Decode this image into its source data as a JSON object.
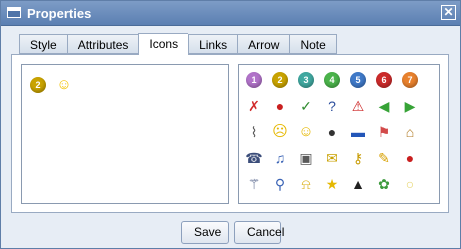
{
  "window": {
    "title": "Properties",
    "close_symbol": "✕"
  },
  "tabs": [
    {
      "label": "Style",
      "active": false
    },
    {
      "label": "Attributes",
      "active": false
    },
    {
      "label": "Icons",
      "active": true
    },
    {
      "label": "Links",
      "active": false
    },
    {
      "label": "Arrow",
      "active": false
    },
    {
      "label": "Note",
      "active": false
    }
  ],
  "selected_icons": [
    {
      "name": "priority-2-icon",
      "text": "2",
      "color": "#c9a300"
    },
    {
      "name": "smiley-icon",
      "text": "☺",
      "color": "#f3c300"
    }
  ],
  "icon_palette": [
    [
      {
        "name": "priority-1-icon",
        "text": "1",
        "color": "#b173c9"
      },
      {
        "name": "priority-2-icon",
        "text": "2",
        "color": "#c9a300"
      },
      {
        "name": "priority-3-icon",
        "text": "3",
        "color": "#40a8a0"
      },
      {
        "name": "priority-4-icon",
        "text": "4",
        "color": "#4bb34b"
      },
      {
        "name": "priority-5-icon",
        "text": "5",
        "color": "#3f79c8"
      },
      {
        "name": "priority-6-icon",
        "text": "6",
        "color": "#cc2b2b"
      },
      {
        "name": "priority-7-icon",
        "text": "7",
        "color": "#e8812d"
      }
    ],
    [
      {
        "name": "cross-flag-icon",
        "text": "✗",
        "color": "#d12b2b"
      },
      {
        "name": "traffic-light-icon",
        "text": "●",
        "color": "#c91f1f"
      },
      {
        "name": "checkmark-icon",
        "text": "✓",
        "color": "#2e8b2e"
      },
      {
        "name": "question-icon",
        "text": "?",
        "color": "#2d4f9e"
      },
      {
        "name": "warning-icon",
        "text": "⚠",
        "color": "#cc2222"
      },
      {
        "name": "arrow-left-icon",
        "text": "◀",
        "color": "#37a337"
      },
      {
        "name": "arrow-right-icon",
        "text": "▶",
        "color": "#37a337"
      }
    ],
    [
      {
        "name": "paperclip-icon",
        "text": "⌇",
        "color": "#5a5a5a"
      },
      {
        "name": "sad-face-icon",
        "text": "☹",
        "color": "#e6b800"
      },
      {
        "name": "smiley-icon",
        "text": "☺",
        "color": "#e6b800"
      },
      {
        "name": "bomb-icon",
        "text": "●",
        "color": "#333333"
      },
      {
        "name": "rectangle-icon",
        "text": "▬",
        "color": "#2356b8"
      },
      {
        "name": "flag-icon",
        "text": "⚑",
        "color": "#d24a4a"
      },
      {
        "name": "house-icon",
        "text": "⌂",
        "color": "#b07a23"
      }
    ],
    [
      {
        "name": "phone-icon",
        "text": "☎",
        "color": "#3b4d7a"
      },
      {
        "name": "music-icon",
        "text": "♫",
        "color": "#3a63b5"
      },
      {
        "name": "computer-icon",
        "text": "▣",
        "color": "#5a5a5a"
      },
      {
        "name": "mail-icon",
        "text": "✉",
        "color": "#c9a100"
      },
      {
        "name": "key-icon",
        "text": "⚷",
        "color": "#c79a00"
      },
      {
        "name": "pencil-icon",
        "text": "✎",
        "color": "#d7a000"
      },
      {
        "name": "stoplight-icon",
        "text": "●",
        "color": "#c91f1f"
      }
    ],
    [
      {
        "name": "magic-wand-icon",
        "text": "⚚",
        "color": "#3b4d7a"
      },
      {
        "name": "magnifier-icon",
        "text": "⚲",
        "color": "#3a63b5"
      },
      {
        "name": "bell-icon",
        "text": "⍾",
        "color": "#d8a900"
      },
      {
        "name": "star-icon",
        "text": "★",
        "color": "#e5b800"
      },
      {
        "name": "penguin-icon",
        "text": "▲",
        "color": "#222222"
      },
      {
        "name": "gear-icon",
        "text": "✿",
        "color": "#3c9a3c"
      },
      {
        "name": "lightbulb-icon",
        "text": "○",
        "color": "#e6d46a"
      }
    ]
  ],
  "buttons": {
    "save": "Save",
    "cancel": "Cancel"
  }
}
